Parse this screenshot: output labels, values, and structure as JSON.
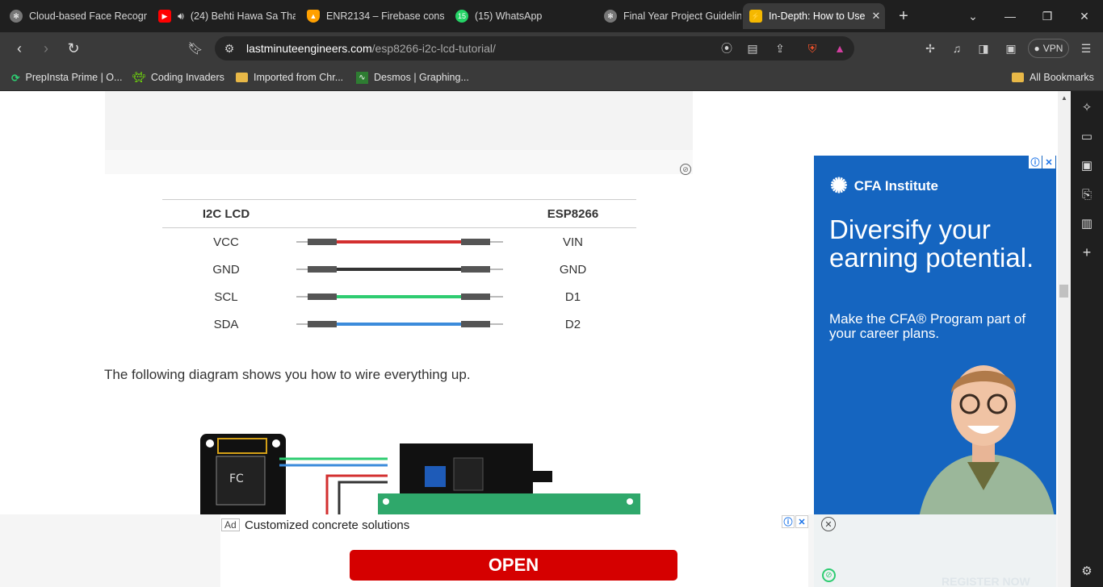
{
  "tabs": [
    {
      "title": "Cloud-based Face Recogn",
      "icon": "chatgpt-icon",
      "color": "#777"
    },
    {
      "title": "(24) Behti Hawa Sa Tha",
      "icon": "youtube-icon",
      "color": "#ff0000"
    },
    {
      "title": "ENR2134 – Firebase conso",
      "icon": "firebase-icon",
      "color": "#ffa000"
    },
    {
      "title": "(15) WhatsApp",
      "icon": "whatsapp-icon",
      "color": "#25d366",
      "badge": "15"
    },
    {
      "title": "Final Year Project Guidelin",
      "icon": "chatgpt-icon",
      "color": "#777"
    },
    {
      "title": "In-Depth: How to Use",
      "icon": "lme-icon",
      "color": "#f5b800"
    }
  ],
  "url": {
    "domain": "lastminuteengineers.com",
    "path": "/esp8266-i2c-lcd-tutorial/"
  },
  "vpn_label": "VPN",
  "bookmarks": [
    {
      "label": "PrepInsta Prime | O...",
      "icon": "prepinsta-icon"
    },
    {
      "label": "Coding Invaders",
      "icon": "invaders-icon"
    },
    {
      "label": "Imported from Chr...",
      "icon": "folder-icon"
    },
    {
      "label": "Desmos | Graphing...",
      "icon": "desmos-icon"
    }
  ],
  "all_bookmarks": "All Bookmarks",
  "pin_table": {
    "headers": [
      "I2C LCD",
      "ESP8266"
    ],
    "rows": [
      {
        "left": "VCC",
        "right": "VIN",
        "wire_color": "#d32f2f"
      },
      {
        "left": "GND",
        "right": "GND",
        "wire_color": "#333333"
      },
      {
        "left": "SCL",
        "right": "D1",
        "wire_color": "#2ecc71"
      },
      {
        "left": "SDA",
        "right": "D2",
        "wire_color": "#3b8bdb"
      }
    ]
  },
  "paragraph": "The following diagram shows you how to wire everything up.",
  "cfa_ad": {
    "brand": "CFA Institute",
    "headline": "Diversify your earning potential.",
    "subline": "Make the CFA® Program part of your career plans."
  },
  "bottom_ad": {
    "tag": "Ad",
    "text": "Customized concrete solutions",
    "button": "OPEN",
    "cta": "REGISTER NOW"
  }
}
